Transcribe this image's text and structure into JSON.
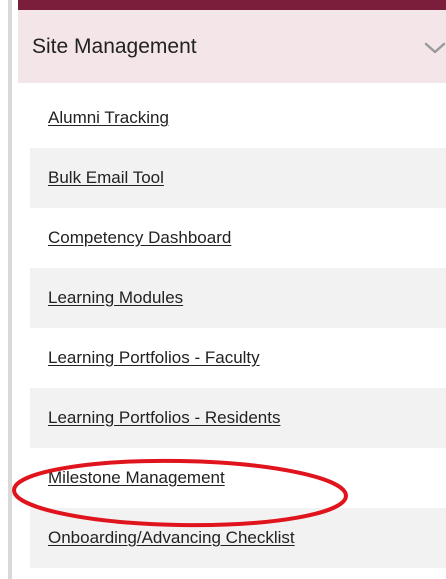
{
  "section": {
    "title": "Site Management"
  },
  "menu": {
    "items": [
      {
        "label": "Alumni Tracking"
      },
      {
        "label": "Bulk Email Tool"
      },
      {
        "label": "Competency Dashboard"
      },
      {
        "label": "Learning Modules"
      },
      {
        "label": "Learning Portfolios - Faculty"
      },
      {
        "label": "Learning Portfolios - Residents"
      },
      {
        "label": "Milestone Management"
      },
      {
        "label": "Onboarding/Advancing Checklist"
      }
    ]
  },
  "colors": {
    "accent": "#7a1e3c",
    "header_bg": "#f4e6e8",
    "annotation": "#e0141c"
  },
  "icons": {
    "expand": "chevron-down-icon"
  }
}
